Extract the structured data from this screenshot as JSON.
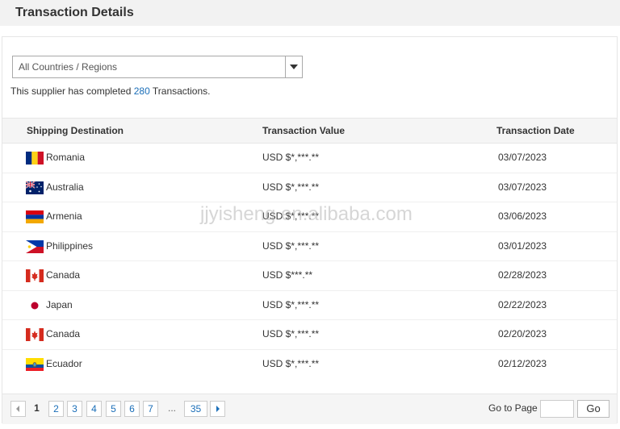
{
  "header": {
    "title": "Transaction Details"
  },
  "filter": {
    "selected": "All Countries / Regions"
  },
  "summary": {
    "prefix": "This supplier has completed ",
    "count": "280",
    "suffix": " Transactions."
  },
  "table": {
    "columns": [
      "Shipping Destination",
      "Transaction Value",
      "Transaction Date"
    ],
    "rows": [
      {
        "country": "Romania",
        "flag": "flag-romania",
        "value": "USD $*,***.**",
        "date": "03/07/2023"
      },
      {
        "country": "Australia",
        "flag": "flag-australia",
        "value": "USD $*,***.**",
        "date": "03/07/2023"
      },
      {
        "country": "Armenia",
        "flag": "flag-armenia",
        "value": "USD $*,***.**",
        "date": "03/06/2023"
      },
      {
        "country": "Philippines",
        "flag": "flag-philippines",
        "value": "USD $*,***.**",
        "date": "03/01/2023"
      },
      {
        "country": "Canada",
        "flag": "flag-canada",
        "value": "USD $***.**",
        "date": "02/28/2023"
      },
      {
        "country": "Japan",
        "flag": "flag-japan",
        "value": "USD $*,***.**",
        "date": "02/22/2023"
      },
      {
        "country": "Canada",
        "flag": "flag-canada",
        "value": "USD $*,***.**",
        "date": "02/20/2023"
      },
      {
        "country": "Ecuador",
        "flag": "flag-ecuador",
        "value": "USD $*,***.**",
        "date": "02/12/2023"
      }
    ]
  },
  "watermark": "jjyisheng.en.alibaba.com",
  "pagination": {
    "pages": [
      "1",
      "2",
      "3",
      "4",
      "5",
      "6",
      "7"
    ],
    "current": "1",
    "ellipsis": "...",
    "last": "35",
    "goto_label": "Go to Page",
    "goto_value": "",
    "go_button": "Go"
  },
  "colors": {
    "link": "#1a6eb8",
    "header_bg": "#f2f2f2",
    "table_head_bg": "#f5f5f5"
  }
}
